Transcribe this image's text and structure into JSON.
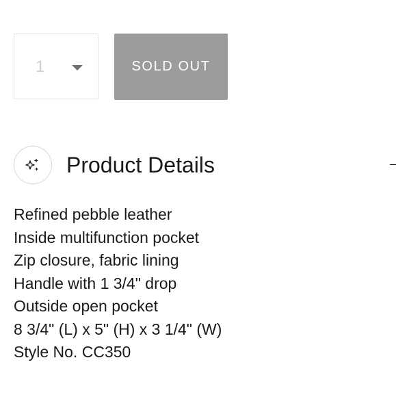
{
  "purchase": {
    "quantity": "1",
    "sold_out_label": "SOLD OUT"
  },
  "product_details": {
    "title": "Product Details",
    "icon": "sparkles-icon",
    "toggle_icon": "minus-icon",
    "items": [
      "Refined pebble leather",
      "Inside multifunction pocket",
      "Zip closure, fabric lining",
      "Handle with 1 3/4\" drop",
      "Outside open pocket",
      "8 3/4\" (L) x 5\" (H) x 3 1/4\" (W)",
      "Style No. CC350"
    ]
  },
  "colors": {
    "button_disabled_bg": "#9b9b9b",
    "text": "#1a1a1a",
    "border": "#e3e3e3"
  }
}
